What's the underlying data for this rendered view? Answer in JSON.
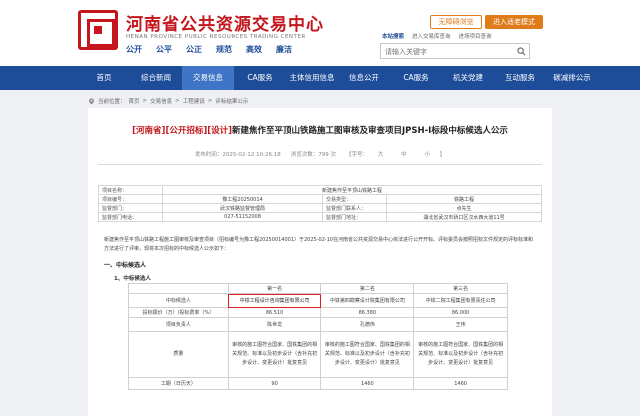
{
  "header": {
    "title": "河南省公共资源交易中心",
    "subtitle": "HENAN PROVINCE PUBLIC RESOURCES TRADING CENTER",
    "slogan": [
      "公开",
      "公平",
      "公正",
      "规范",
      "高效",
      "廉洁"
    ],
    "accessible_btn": "无障碍浏览",
    "old_version_btn": "进入适老模式",
    "search_tabs": [
      "本站搜索",
      "进入交易库查询",
      "进场项目查询"
    ],
    "search_placeholder": "请输入关键字"
  },
  "nav": [
    "首页",
    "综合新闻",
    "交易信息",
    "CA服务",
    "主体信用信息",
    "信息公开",
    "CA服务",
    "机关党建",
    "互动服务",
    "碳减排公示"
  ],
  "breadcrumb": [
    "当前位置：",
    "首页",
    ">",
    "交易信息",
    ">",
    "工程建设",
    ">",
    "评标结果公示"
  ],
  "article": {
    "tag1": "[河南省]",
    "tag2": "[公开招标]",
    "tag3": "[设计]",
    "title": "新建焦作至平顶山铁路施工图审核及审查项目JPSH-Ⅰ标段中标候选人公示",
    "date": "发布时间：2025-02-12 10:26:18",
    "views": "浏览次数：799 次",
    "font_label": "【字号：",
    "font_large": "大",
    "font_medium": "中",
    "font_small": "小",
    "font_end": "】"
  },
  "info": {
    "project_name_label": "项目名称：",
    "project_name": "新建焦作至平顶山铁路工程",
    "project_no_label": "项目编号：",
    "project_no": "豫工程20250014",
    "trade_type_label": "交易类型：",
    "trade_type": "铁路工程",
    "dept_label": "监督部门：",
    "dept": "武汉铁路监督管理局",
    "contact_label": "监督部门联系人：",
    "contact": "点先生",
    "phone_label": "监督部门电话：",
    "phone": "027-51152008",
    "addr_label": "监督部门地址：",
    "addr": "湖北省武汉市硚口区汉水西大道11号"
  },
  "body_text": "新建焦作至平顶山铁路工程施工图审核及审查项目（招标编号为豫工程20250014001）于2025-02-10在河南省公共资源交易中心依法进行公开开标。评标委员会按照招标文件规定的评标标准和方法进行了评审，现将本次招标的中标候选人公示如下：",
  "section": "一、中标候选人",
  "sub_section": "1、中标候选人",
  "candidates": {
    "rank_label": "",
    "ranks": [
      "第一名",
      "第二名",
      "第三名"
    ],
    "name_label": "中标候选人",
    "names": [
      "中铁工程设计咨询集团有限公司",
      "中铁第四勘察设计院集团有限公司",
      "中铁二院工程集团有限责任公司"
    ],
    "price_label": "投标报价（万）/投标费率（%）",
    "prices": [
      "86.510",
      "86.380",
      "86.000"
    ],
    "leader_label": "项目负责人",
    "leaders": [
      "陈世龙",
      "孔德伟",
      "王伟"
    ],
    "quality_label": "质量",
    "quality": "审核的施工图符合国家、国铁集团的相关规范、标准以及初步设计（含补充初步设计、变更设计）批复意见",
    "period_label": "工期（日历天）",
    "periods": [
      "90",
      "1460",
      "1460"
    ]
  }
}
